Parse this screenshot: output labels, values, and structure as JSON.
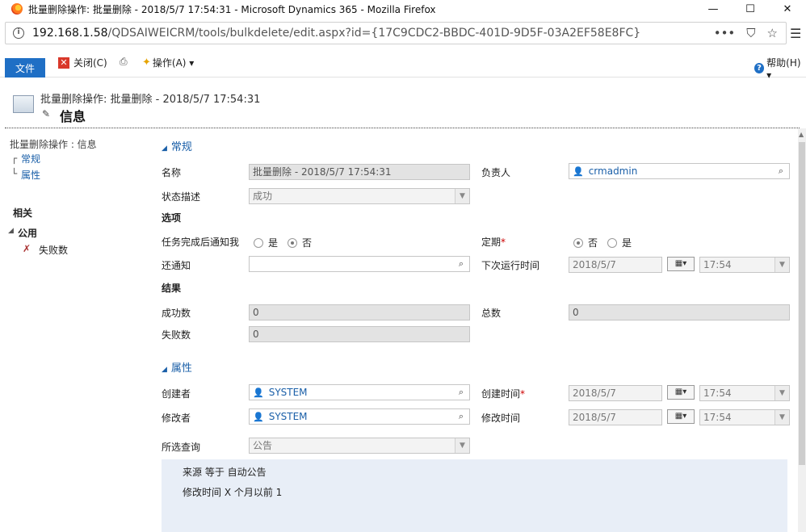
{
  "window": {
    "title": "批量删除操作: 批量删除 - 2018/5/7 17:54:31 - Microsoft Dynamics 365 - Mozilla Firefox",
    "minimize": "—",
    "maximize": "☐",
    "close": "✕"
  },
  "urlbar": {
    "host": "192.168.1.58",
    "path": "/QDSAIWEICRM/tools/bulkdelete/edit.aspx?id={17C9CDC2-BBDC-401D-9D5F-03A2EF58E8FC}",
    "more": "•••",
    "pocket": "⛉",
    "bookmark": "☆"
  },
  "ribbon": {
    "file": "文件",
    "close": "关闭(C)",
    "actions": "操作(A) ▾",
    "help": "帮助(H) ▾"
  },
  "header": {
    "record_title": "批量删除操作: 批量删除 - 2018/5/7 17:54:31",
    "form_name": "信息"
  },
  "nav": {
    "crumb": "批量删除操作 : 信息",
    "links": [
      "常规",
      "属性"
    ],
    "related": "相关",
    "common": "公用",
    "failures": "失败数"
  },
  "sections": {
    "general": "常规",
    "options": "选项",
    "results": "结果",
    "properties": "属性"
  },
  "fields": {
    "name_label": "名称",
    "name_value": "批量删除 - 2018/5/7 17:54:31",
    "owner_label": "负责人",
    "owner_value": "crmadmin",
    "status_label": "状态描述",
    "status_value": "成功",
    "notify_label": "任务完成后通知我",
    "notify_yes": "是",
    "notify_no": "否",
    "recurring_label": "定期",
    "recurring_no": "否",
    "recurring_yes": "是",
    "cc_label": "还通知",
    "next_run_label": "下次运行时间",
    "next_run_date": "2018/5/7",
    "next_run_time": "17:54",
    "success_label": "成功数",
    "success_value": "0",
    "total_label": "总数",
    "total_value": "0",
    "failure_label": "失败数",
    "failure_value": "0",
    "created_by_label": "创建者",
    "created_by_value": "SYSTEM",
    "created_on_label": "创建时间",
    "created_on_date": "2018/5/7",
    "created_on_time": "17:54",
    "modified_by_label": "修改者",
    "modified_by_value": "SYSTEM",
    "modified_on_label": "修改时间",
    "modified_on_date": "2018/5/7",
    "modified_on_time": "17:54",
    "query_label": "所选查询",
    "query_value": "公告",
    "required_mark": "*"
  },
  "query": {
    "line1": "来源  等于   自动公告",
    "line2": "修改时间  X 个月以前    1"
  }
}
